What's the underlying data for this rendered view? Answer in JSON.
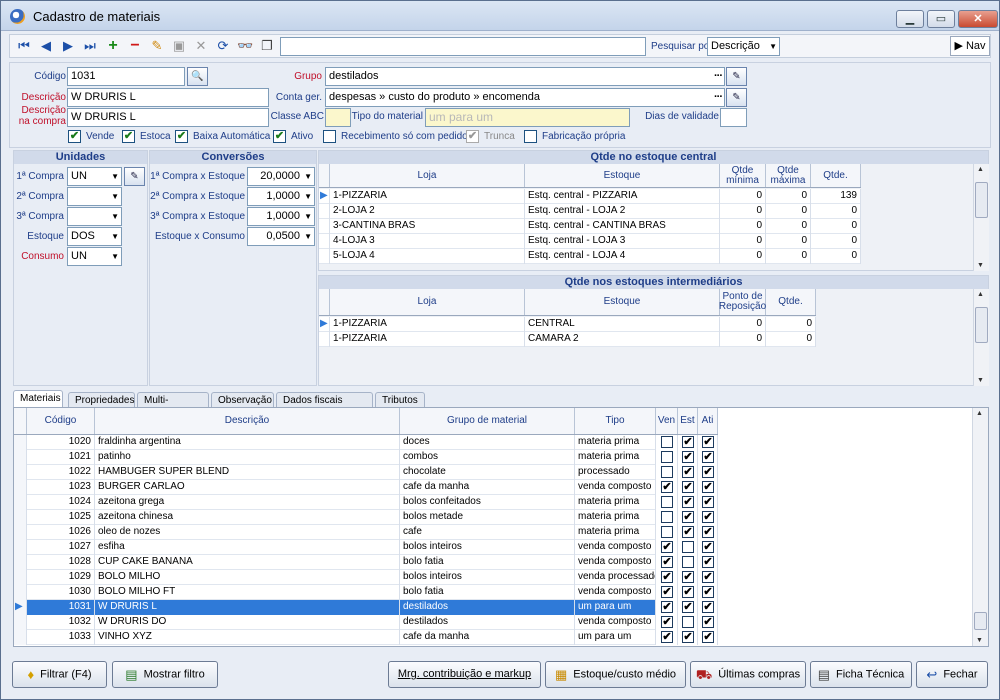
{
  "window": {
    "title": "Cadastro de materiais",
    "min": "▁",
    "max": "▭",
    "close": "✕"
  },
  "toolbar": {
    "search_value": "",
    "pesquisar_label": "Pesquisar por",
    "pesquisar_value": "Descrição",
    "nav_label": "Nav",
    "icons": {
      "first": "⏮",
      "prev": "◀",
      "next": "▶",
      "last": "⏭",
      "add": "+",
      "remove": "−",
      "edit": "✎",
      "save": "▣",
      "cancel": "✕",
      "refresh": "⟳",
      "find": "👓",
      "copy": "❐"
    }
  },
  "form": {
    "codigo_label": "Código",
    "codigo": "1031",
    "descricao_label": "Descrição",
    "descricao": "W DRURIS L",
    "desc_compra_label1": "Descrição",
    "desc_compra_label2": "na compra",
    "desc_compra": "W DRURIS L",
    "grupo_label": "Grupo",
    "grupo": "destilados",
    "conta_label": "Conta ger.",
    "conta": "despesas » custo do produto  » encomenda",
    "classe_label": "Classe ABC",
    "classe": "",
    "tipo_label": "Tipo do material",
    "tipo": "um para um",
    "dias_label": "Dias de validade",
    "dias": "",
    "checks": [
      {
        "label": "Vende",
        "checked": "✔"
      },
      {
        "label": "Estoca",
        "checked": "✔"
      },
      {
        "label": "Baixa Automática",
        "checked": "✔"
      },
      {
        "label": "Ativo",
        "checked": "✔"
      },
      {
        "label": "Recebimento só com pedido",
        "checked": ""
      },
      {
        "label": "Trunca",
        "checked": "✔"
      },
      {
        "label": "Fabricação própria",
        "checked": ""
      }
    ]
  },
  "unidades": {
    "title": "Unidades",
    "rows": [
      {
        "label": "1ª Compra",
        "value": "UN"
      },
      {
        "label": "2ª Compra",
        "value": ""
      },
      {
        "label": "3ª Compra",
        "value": ""
      },
      {
        "label": "Estoque",
        "value": "DOS"
      },
      {
        "label": "Consumo",
        "value": "UN"
      }
    ]
  },
  "conversoes": {
    "title": "Conversões",
    "rows": [
      {
        "label": "1ª Compra x Estoque",
        "value": "20,0000"
      },
      {
        "label": "2ª Compra x Estoque",
        "value": "1,0000"
      },
      {
        "label": "3ª Compra x Estoque",
        "value": "1,0000"
      },
      {
        "label": "Estoque x Consumo",
        "value": "0,0500"
      }
    ]
  },
  "estoque_central": {
    "title": "Qtde no estoque central",
    "headers": {
      "loja": "Loja",
      "estoque": "Estoque",
      "min1": "Qtde",
      "min2": "mínima",
      "max1": "Qtde",
      "max2": "máxima",
      "qtde": "Qtde."
    },
    "rows": [
      {
        "loja": "1-PIZZARIA",
        "estoque": "Estq. central - PIZZARIA",
        "min": "0",
        "max": "0",
        "qtde": "139"
      },
      {
        "loja": "2-LOJA 2",
        "estoque": "Estq. central - LOJA 2",
        "min": "0",
        "max": "0",
        "qtde": "0"
      },
      {
        "loja": "3-CANTINA BRAS",
        "estoque": "Estq. central - CANTINA BRAS",
        "min": "0",
        "max": "0",
        "qtde": "0"
      },
      {
        "loja": "4-LOJA 3",
        "estoque": "Estq. central - LOJA 3",
        "min": "0",
        "max": "0",
        "qtde": "0"
      },
      {
        "loja": "5-LOJA 4",
        "estoque": "Estq. central - LOJA 4",
        "min": "0",
        "max": "0",
        "qtde": "0"
      }
    ]
  },
  "estoque_inter": {
    "title": "Qtde nos estoques intermediários",
    "headers": {
      "loja": "Loja",
      "estoque": "Estoque",
      "ponto1": "Ponto de",
      "ponto2": "Reposição",
      "qtde": "Qtde."
    },
    "rows": [
      {
        "loja": "1-PIZZARIA",
        "estoque": "CENTRAL",
        "ponto": "0",
        "qtde": "0"
      },
      {
        "loja": "1-PIZZARIA",
        "estoque": "CAMARA 2",
        "ponto": "0",
        "qtde": "0"
      }
    ]
  },
  "tabs": [
    "Materiais",
    "Propriedades",
    "Multi-Estoque",
    "Observação",
    "Dados fiscais (EFD)",
    "Tributos"
  ],
  "grid": {
    "headers": {
      "codigo": "Código",
      "descricao": "Descrição",
      "grupo": "Grupo de material",
      "tipo": "Tipo",
      "ven": "Ven",
      "est": "Est",
      "ati": "Ati"
    },
    "rows": [
      {
        "codigo": "1020",
        "descricao": "fraldinha argentina",
        "grupo": "doces",
        "tipo": "materia prima",
        "ven": "",
        "est": "✔",
        "ati": "✔"
      },
      {
        "codigo": "1021",
        "descricao": "patinho",
        "grupo": "combos",
        "tipo": "materia prima",
        "ven": "",
        "est": "✔",
        "ati": "✔"
      },
      {
        "codigo": "1022",
        "descricao": "HAMBUGER SUPER BLEND",
        "grupo": "chocolate",
        "tipo": "processado",
        "ven": "",
        "est": "✔",
        "ati": "✔"
      },
      {
        "codigo": "1023",
        "descricao": "BURGER CARLAO",
        "grupo": "cafe da manha",
        "tipo": "venda composto",
        "ven": "✔",
        "est": "✔",
        "ati": "✔"
      },
      {
        "codigo": "1024",
        "descricao": "azeitona grega",
        "grupo": "bolos confeitados",
        "tipo": "materia prima",
        "ven": "",
        "est": "✔",
        "ati": "✔"
      },
      {
        "codigo": "1025",
        "descricao": "azeitona chinesa",
        "grupo": "bolos metade",
        "tipo": "materia prima",
        "ven": "",
        "est": "✔",
        "ati": "✔"
      },
      {
        "codigo": "1026",
        "descricao": "oleo de nozes",
        "grupo": "cafe",
        "tipo": "materia prima",
        "ven": "",
        "est": "✔",
        "ati": "✔"
      },
      {
        "codigo": "1027",
        "descricao": "esfiha",
        "grupo": "bolos inteiros",
        "tipo": "venda composto",
        "ven": "✔",
        "est": "",
        "ati": "✔"
      },
      {
        "codigo": "1028",
        "descricao": "CUP CAKE BANANA",
        "grupo": "bolo fatia",
        "tipo": "venda composto",
        "ven": "✔",
        "est": "",
        "ati": "✔"
      },
      {
        "codigo": "1029",
        "descricao": "BOLO MILHO",
        "grupo": "bolos inteiros",
        "tipo": "venda processado",
        "ven": "✔",
        "est": "✔",
        "ati": "✔"
      },
      {
        "codigo": "1030",
        "descricao": "BOLO MILHO FT",
        "grupo": "bolo fatia",
        "tipo": "venda composto",
        "ven": "✔",
        "est": "✔",
        "ati": "✔"
      },
      {
        "codigo": "1031",
        "descricao": "W DRURIS L",
        "grupo": "destilados",
        "tipo": "um para um",
        "ven": "✔",
        "est": "✔",
        "ati": "✔"
      },
      {
        "codigo": "1032",
        "descricao": "W DRURIS DO",
        "grupo": "destilados",
        "tipo": "venda composto",
        "ven": "✔",
        "est": "",
        "ati": "✔"
      },
      {
        "codigo": "1033",
        "descricao": "VINHO XYZ",
        "grupo": "cafe da manha",
        "tipo": "um para um",
        "ven": "✔",
        "est": "✔",
        "ati": "✔"
      }
    ]
  },
  "buttons": {
    "filtrar": "Filtrar (F4)",
    "mostrar": "Mostrar filtro",
    "mrg": "Mrg. contribuição e markup",
    "estoque": "Estoque/custo médio",
    "ultimas": "Últimas compras",
    "ficha": "Ficha Técnica",
    "fechar": "Fechar",
    "icons": {
      "filtrar": "♦",
      "mostrar": "▤",
      "estoque": "▦",
      "ultimas": "⛟",
      "ficha": "▤",
      "fechar": "↩"
    }
  }
}
